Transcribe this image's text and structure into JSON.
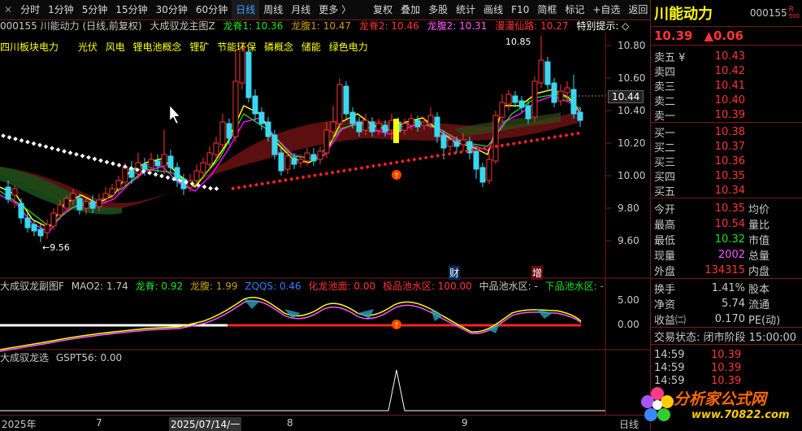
{
  "toolbar": {
    "items": [
      "分时",
      "1分钟",
      "5分钟",
      "15分钟",
      "30分钟",
      "60分钟",
      "日线",
      "周线",
      "月线",
      "更多 〉"
    ],
    "active_index": 6,
    "tools": [
      "复权",
      "叠加",
      "多股",
      "统计",
      "画线",
      "F10",
      "简框",
      "标记",
      "+自选",
      "返回"
    ],
    "close_icon": "✕"
  },
  "chart_info": {
    "code_name": "000155 川能动力 (日线,前复权)",
    "indicator_name": "大成驭龙主图Z",
    "items": [
      {
        "label": "龙脊1: 10.36",
        "color": "#19e619"
      },
      {
        "label": "龙腹1: 10.47",
        "color": "#c8a000"
      },
      {
        "label": "龙脊2: 10.46",
        "color": "#ff3333"
      },
      {
        "label": "龙腹2: 10.31",
        "color": "#ff55ff"
      },
      {
        "label": "漫漫仙路: 10.27",
        "color": "#ff3333"
      },
      {
        "label": "特别提示: ◇",
        "color": "#ffffff"
      }
    ]
  },
  "concepts": [
    "四川板块电力",
    "光伏",
    "风电",
    "锂电池概念",
    "锂矿",
    "节能环保",
    "磷概念",
    "储能",
    "绿色电力"
  ],
  "price_labels": [
    "10.80",
    "10.60",
    "10.40",
    "10.20",
    "10.00",
    "9.80",
    "9.60"
  ],
  "current_price_tag": "10.44",
  "high_mark": "10.85",
  "low_mark": "←9.56",
  "event_marks": {
    "cai": "财",
    "zeng": "增"
  },
  "sub1": {
    "title": "大成驭龙副图F",
    "items": [
      {
        "label": "MAO2: 1.74",
        "color": "#c8c8c8"
      },
      {
        "label": "龙脊: 0.92",
        "color": "#19e619"
      },
      {
        "label": "龙腹: 1.99",
        "color": "#c8a000"
      },
      {
        "label": "ZQQS: 0.46",
        "color": "#3a7aff"
      },
      {
        "label": "化龙池面: 0.00",
        "color": "#ff3333"
      },
      {
        "label": "极品池水区: 100.00",
        "color": "#ff3333"
      },
      {
        "label": "中品池水区: -",
        "color": "#c8c8c8"
      },
      {
        "label": "下品池水区: -",
        "color": "#19e619"
      }
    ],
    "axis": [
      "5.00",
      "0.00"
    ]
  },
  "sub2": {
    "title": "大成驭龙选",
    "items": [
      {
        "label": "GSPT56: 0.00",
        "color": "#c8c8c8"
      }
    ]
  },
  "date_axis": [
    "2025年",
    "7",
    "2025/07/14/一",
    "8",
    "9",
    "日线"
  ],
  "right": {
    "name": "川能动力",
    "code": "000155",
    "badge_r": "R",
    "badge_num": "500",
    "price": "10.39",
    "change": "▲0.06",
    "sell": [
      {
        "label": "卖五 ¥",
        "price": "10.43"
      },
      {
        "label": "卖四",
        "price": "10.42"
      },
      {
        "label": "卖三",
        "price": "10.41"
      },
      {
        "label": "卖二",
        "price": "10.40"
      },
      {
        "label": "卖一",
        "price": "10.39"
      }
    ],
    "buy": [
      {
        "label": "买一",
        "price": "10.38"
      },
      {
        "label": "买二",
        "price": "10.37"
      },
      {
        "label": "买三",
        "price": "10.36"
      },
      {
        "label": "买四",
        "price": "10.35"
      },
      {
        "label": "买五",
        "price": "10.34"
      }
    ],
    "quote1": [
      {
        "l": "今开",
        "v": "10.35",
        "c": "#ff3333",
        "l2": "均价"
      },
      {
        "l": "最高",
        "v": "10.54",
        "c": "#ff3333",
        "l2": "量比"
      },
      {
        "l": "最低",
        "v": "10.32",
        "c": "#19e619",
        "l2": "市值"
      },
      {
        "l": "现量",
        "v": "2002",
        "c": "#ff55ff",
        "l2": "总量"
      },
      {
        "l": "外盘",
        "v": "134315",
        "c": "#ff3333",
        "l2": "内盘"
      }
    ],
    "quote2": [
      {
        "l": "换手",
        "v": "1.41%",
        "c": "#c8c8c8",
        "l2": "股本"
      },
      {
        "l": "净资",
        "v": "5.74",
        "c": "#c8c8c8",
        "l2": "流通"
      },
      {
        "l": "收益㈡",
        "v": "0.170",
        "c": "#c8c8c8",
        "l2": "PE(动)"
      }
    ],
    "status": "交易状态: 闭市阶段 15:00:00",
    "ticks": [
      {
        "t": "14:59",
        "p": "10.39"
      },
      {
        "t": "14:59",
        "p": "10.39"
      },
      {
        "t": "14:59",
        "p": "10.39"
      }
    ]
  },
  "watermark": {
    "title": "分析家公式网",
    "url": "www.70822.com"
  }
}
